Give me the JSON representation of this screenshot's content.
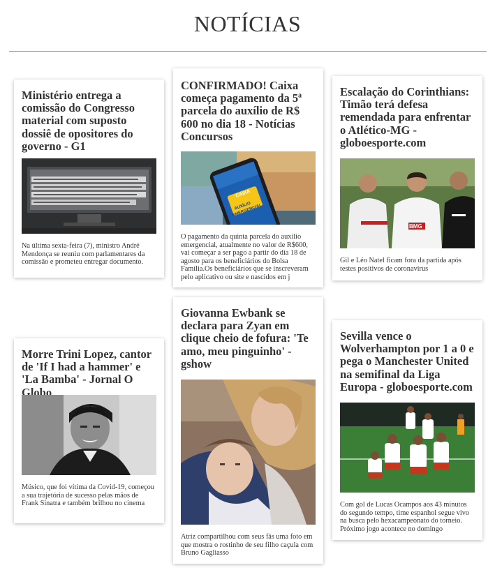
{
  "page": {
    "title": "NOTÍCIAS"
  },
  "articles": [
    {
      "title": "Ministério entrega a comissão do Congresso material com suposto dossiê de opositores do governo - G1",
      "description": "Na última sexta-feira (7), ministro André Mendonça se reuniu com parlamentares da comissão e prometeu entregar documento.",
      "image": "document-on-monitor",
      "image_text": "Temos na atividade a Polícia Federal o instauração do inquérito policial por ocasião do medidas do bloco policiais cabíveis para a apuração do vazamento de informações a conferência do documentos relacionados a atividade do inteligência"
    },
    {
      "title": "CONFIRMADO! Caixa começa pagamento da 5ª parcela do auxílio de R$ 600 no dia 18 - Notícias Concursos",
      "description": "O pagamento da quinta parcela do auxílio emergencial, atualmente no valor de R$600, vai começar a ser pago a partir do dia 18 de agosto para os beneficiários do Bolsa Família.Os beneficiários que se inscreveram pelo aplicativo ou site e nascidos em j",
      "image": "phone-auxilio-app",
      "image_text": "AUXÍLIO EMERGENCIAL",
      "image_brand": "CAIXA"
    },
    {
      "title": "Escalação do Corinthians: Timão terá defesa remendada para enfrentar o Atlético-MG - globoesporte.com",
      "description": "Gil e Léo Natel ficam fora da partida após testes positivos de coronavírus",
      "image": "football-players-training",
      "image_text": "BMG"
    },
    {
      "title": "Morre Trini Lopez, cantor de 'If I had a hammer' e 'La Bamba' - Jornal O Globo",
      "description": "Músico, que foi vítima da Covid-19, começou a sua trajetória de sucesso pelas mãos de Frank Sinatra e também brilhou no cinema",
      "image": "bw-portrait-singer"
    },
    {
      "title": "Giovanna Ewbank se declara para Zyan em clique cheio de fofura: 'Te amo, meu pinguinho' - gshow",
      "description": "Atriz compartilhou com seus fãs uma foto em que mostra o rostinho de seu filho caçula com Bruno Gagliasso",
      "image": "mother-with-baby"
    },
    {
      "title": "Sevilla vence o Wolverhampton por 1 a 0 e pega o Manchester United na semifinal da Liga Europa - globoesporte.com",
      "description": "Com gol de Lucas Ocampos aos 43 minutos do segundo tempo, time espanhol segue vivo na busca pelo hexacampeonato do torneio. Próximo jogo acontece no domingo",
      "image": "sevilla-celebration"
    }
  ],
  "colors": {
    "text": "#333333",
    "rule": "#999999",
    "card_bg": "#ffffff"
  }
}
